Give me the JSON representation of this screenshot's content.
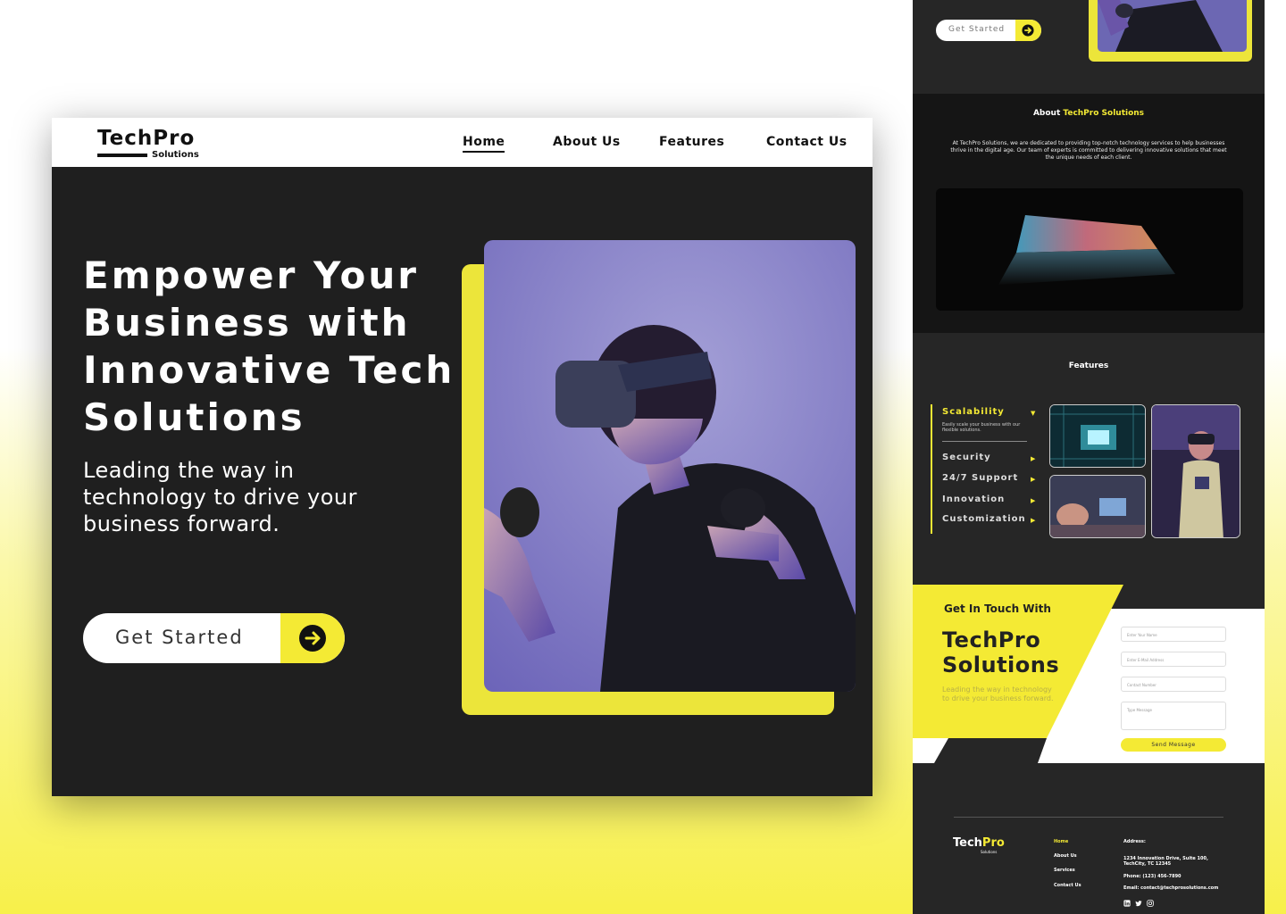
{
  "desktop": {
    "logo": {
      "brand": "TechPro",
      "sub": "Solutions"
    },
    "nav": [
      {
        "label": "Home"
      },
      {
        "label": "About Us"
      },
      {
        "label": "Features"
      },
      {
        "label": "Contact Us"
      }
    ],
    "hero": {
      "title": "Empower Your Business with Innovative Tech Solutions",
      "subtitle": "Leading the way in technology to drive your business forward.",
      "cta": "Get Started"
    }
  },
  "mobile": {
    "cta": "Get Started",
    "about": {
      "title_prefix": "About ",
      "title_highlight": "TechPro Solutions",
      "description": "At TechPro Solutions, we are dedicated to providing top-notch technology services to help businesses thrive in the digital age. Our team of experts is committed to delivering innovative solutions that meet the unique needs of each client."
    },
    "features": {
      "title": "Features",
      "items": [
        {
          "label": "Scalability",
          "arrow": "▼"
        },
        {
          "label": "Security",
          "arrow": "▶"
        },
        {
          "label": "24/7 Support",
          "arrow": "▶"
        },
        {
          "label": "Innovation",
          "arrow": "▶"
        },
        {
          "label": "Customization",
          "arrow": "▶"
        }
      ],
      "active_desc": "Easily scale your business with our flexible solutions."
    },
    "contact": {
      "heading": "Get In Touch With",
      "brand_line1": "TechPro",
      "brand_line2": "Solutions",
      "tagline": "Leading the way in technology to drive your business forward.",
      "fields": {
        "name": "Enter Your Name",
        "email": "Enter E-Mail Address",
        "phone": "Contact Number",
        "message": "Type Message"
      },
      "send": "Send Message"
    },
    "footer": {
      "logo_a": "Tech",
      "logo_b": "Pro",
      "logo_sub": "Solutions",
      "links": [
        {
          "label": "Home"
        },
        {
          "label": "About Us"
        },
        {
          "label": "Services"
        },
        {
          "label": "Contact Us"
        }
      ],
      "address_label": "Address:",
      "address": "1234 Innovation Drive, Suite 100, TechCity, TC 12345",
      "phone": "Phone: (123) 456-7890",
      "email": "Email: contact@techprosolutions.com",
      "social": [
        "linkedin-icon",
        "twitter-icon",
        "instagram-icon"
      ]
    }
  },
  "colors": {
    "accent": "#f4ea34",
    "dark": "#1f1f1f",
    "darker": "#151515"
  }
}
